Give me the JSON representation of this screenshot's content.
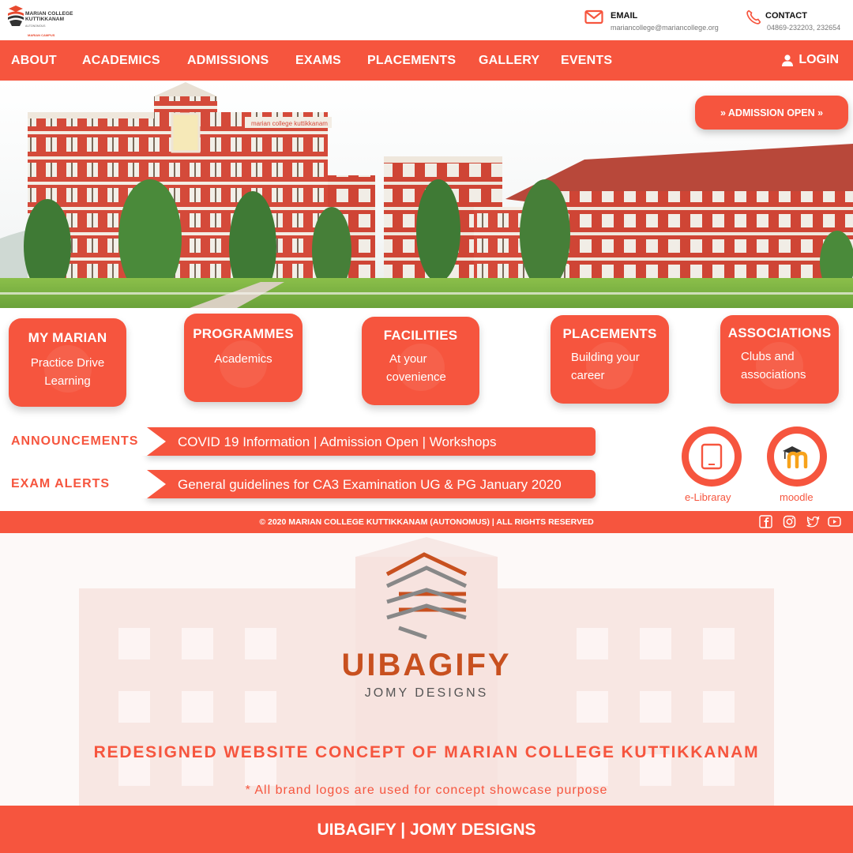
{
  "header": {
    "logo_line1": "MARIAN COLLEGE",
    "logo_line2": "KUTTIKKANAM",
    "logo_sub": "AUTONOMOUS",
    "logo_tag": "MARIAN CAMPUS",
    "email_title": "EMAIL",
    "email_value": "mariancollege@mariancollege.org",
    "contact_title": "CONTACT",
    "contact_value": "04869-232203, 232654"
  },
  "nav": {
    "items": [
      "ABOUT",
      "ACADEMICS",
      "ADMISSIONS",
      "EXAMS",
      "PLACEMENTS",
      "GALLERY",
      "EVENTS"
    ],
    "login_label": "LOGIN"
  },
  "hero": {
    "building_sign": "marian college kuttikkanam",
    "admission_label": "» ADMISSION OPEN »"
  },
  "cards": [
    {
      "title": "MY MARIAN",
      "sub1": "Practice Drive",
      "sub2": "Learning"
    },
    {
      "title": "PROGRAMMES",
      "sub1": "Academics",
      "sub2": ""
    },
    {
      "title": "FACILITIES",
      "sub1": "At your",
      "sub2": "covenience"
    },
    {
      "title": "PLACEMENTS",
      "sub1": "Building your",
      "sub2": "career"
    },
    {
      "title": "ASSOCIATIONS",
      "sub1": "Clubs and",
      "sub2": "associations"
    }
  ],
  "announcements": {
    "label": "ANNOUNCEMENTS",
    "text": "COVID 19 Information | Admission Open | Workshops"
  },
  "exam_alerts": {
    "label": "EXAM ALERTS",
    "text": "General guidelines for CA3 Examination UG & PG January 2020"
  },
  "quick_links": {
    "elibrary": "e-Libraray",
    "moodle": "moodle"
  },
  "footer": {
    "copyright": "© 2020 MARIAN COLLEGE KUTTIKKANAM (AUTONOMUS) | ALL RIGHTS RESERVED",
    "social": [
      "facebook-icon",
      "instagram-icon",
      "twitter-icon",
      "youtube-icon"
    ]
  },
  "showcase": {
    "brand": "UIBAGIFY",
    "brand_sub": "JOMY DESIGNS",
    "headline": "REDESIGNED WEBSITE CONCEPT OF MARIAN COLLEGE KUTTIKKANAM",
    "note": "* All brand logos are used for concept  showcase purpose"
  },
  "bottom": {
    "text": "UIBAGIFY | JOMY DESIGNS"
  },
  "colors": {
    "accent": "#f6553e",
    "brand_brown": "#c8501f",
    "building_red": "#d44a3a"
  }
}
